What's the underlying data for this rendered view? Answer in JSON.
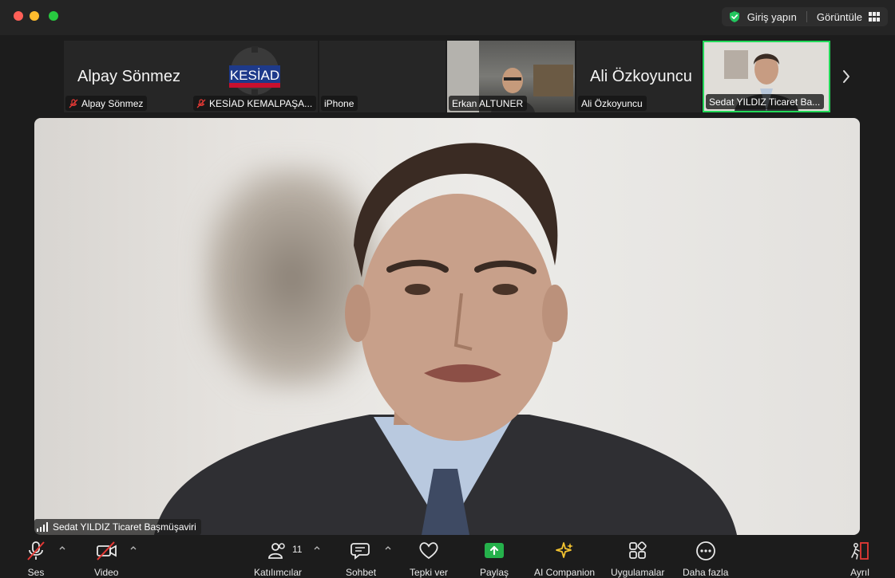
{
  "titlebar": {
    "sign_in_label": "Giriş yapın",
    "view_label": "Görüntüle"
  },
  "participants": [
    {
      "display_name": "Alpay Sönmez",
      "label": "Alpay Sönmez",
      "muted": true,
      "video": false
    },
    {
      "display_name": "KESİAD",
      "label": "KESİAD KEMALPAŞA...",
      "muted": true,
      "video": false
    },
    {
      "display_name": "",
      "label": "iPhone",
      "muted": false,
      "video": true
    },
    {
      "display_name": "",
      "label": "Erkan ALTUNER",
      "muted": false,
      "video": true
    },
    {
      "display_name": "Ali Özkoyuncu",
      "label": "Ali Özkoyuncu",
      "muted": false,
      "video": false
    },
    {
      "display_name": "",
      "label": "Sedat YILDIZ Ticaret Ba...",
      "muted": false,
      "video": true,
      "active_speaker": true
    }
  ],
  "main_speaker": {
    "name": "Sedat YILDIZ Ticaret Başmüşaviri"
  },
  "toolbar": {
    "audio": "Ses",
    "video": "Video",
    "participants": "Katılımcılar",
    "participants_count": "11",
    "chat": "Sohbet",
    "react": "Tepki ver",
    "share": "Paylaş",
    "ai_companion": "AI Companion",
    "apps": "Uygulamalar",
    "more": "Daha fazla",
    "leave": "Ayrıl"
  },
  "colors": {
    "accent_green": "#23d959",
    "share_green": "#25b14b",
    "leave_red": "#e53935",
    "muted_red": "#e53935"
  }
}
